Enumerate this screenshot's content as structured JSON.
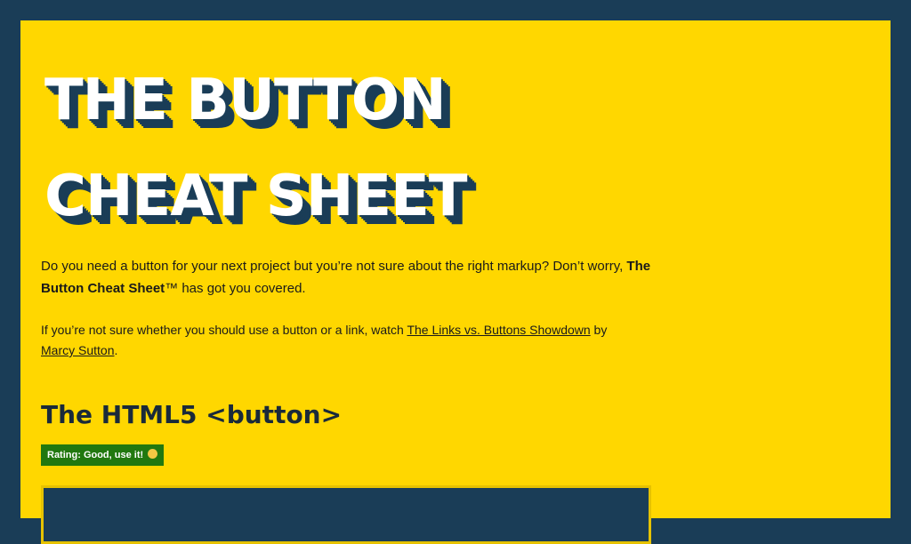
{
  "header": {
    "title_line1": "THE BUTTON",
    "title_line2": "CHEAT SHEET"
  },
  "intro": {
    "part1": "Do you need a button for your next project but you’re not sure about the right markup? Don’t worry, ",
    "strong": "The Button Cheat Sheet",
    "part2": "™ has got you covered."
  },
  "intro2": {
    "part1": "If you’re not sure whether you should use a button or a link, watch ",
    "link1": "The Links vs. Buttons Showdown",
    "part2": " by ",
    "link2": "Marcy Sutton",
    "part3": "."
  },
  "section": {
    "heading": "The HTML5 <button>",
    "badge": "Rating: Good, use it!",
    "badge_icon": "smiley-emoji-icon"
  },
  "colors": {
    "frame": "#1a3d57",
    "background": "#ffd700",
    "badge": "#21780f"
  }
}
